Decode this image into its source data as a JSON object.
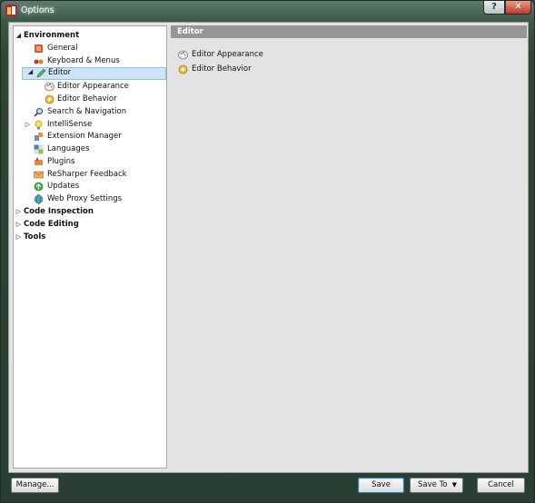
{
  "window": {
    "title": "Options",
    "help_label": "?",
    "close_label": "✕"
  },
  "tree": {
    "environment": "Environment",
    "general": "General",
    "keyboard": "Keyboard & Menus",
    "editor": "Editor",
    "editor_appearance": "Editor Appearance",
    "editor_behavior": "Editor Behavior",
    "search": "Search & Navigation",
    "intellisense": "IntelliSense",
    "extension_manager": "Extension Manager",
    "languages": "Languages",
    "plugins": "Plugins",
    "feedback": "ReSharper Feedback",
    "updates": "Updates",
    "proxy": "Web Proxy Settings",
    "code_inspection": "Code Inspection",
    "code_editing": "Code Editing",
    "tools": "Tools"
  },
  "panel": {
    "header": "Editor",
    "links": [
      "Editor Appearance",
      "Editor Behavior"
    ]
  },
  "buttons": {
    "manage": "Manage...",
    "save": "Save",
    "save_to": "Save To",
    "cancel": "Cancel"
  }
}
